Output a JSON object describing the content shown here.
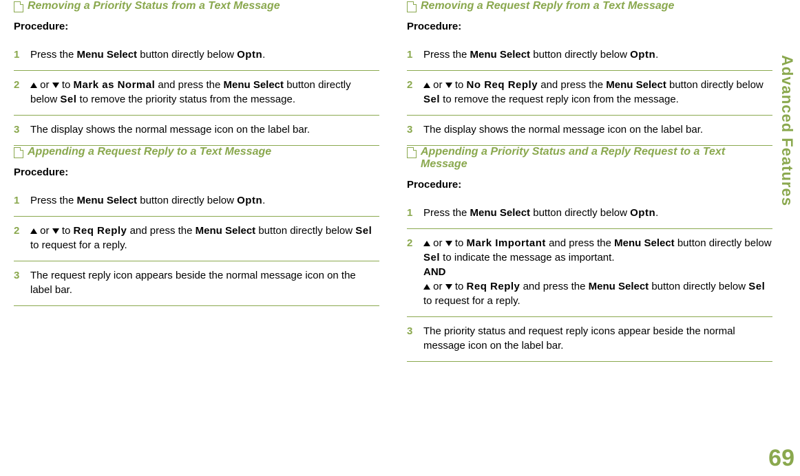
{
  "side_label": "Advanced Features",
  "page_number": "69",
  "procedure_label": "Procedure:",
  "ui": {
    "menu_select": "Menu Select",
    "optn": "Optn",
    "sel": "Sel",
    "mark_as_normal": "Mark as Normal",
    "req_reply": "Req Reply",
    "no_req_reply": "No Req Reply",
    "mark_important": "Mark Important",
    "and": "AND"
  },
  "sections": [
    {
      "title": "Removing a Priority Status from a Text Message",
      "steps": [
        {
          "n": "1",
          "t": [
            "Press the ",
            "@menu_select",
            " button directly below ",
            "@optn",
            "."
          ]
        },
        {
          "n": "2",
          "t": [
            "@up",
            " or ",
            "@down",
            " to ",
            "@mark_as_normal",
            " and press the ",
            "@menu_select",
            " button directly below ",
            "@sel",
            " to remove the priority status from the message."
          ]
        },
        {
          "n": "3",
          "t": [
            "The display shows the normal message icon on the label bar."
          ]
        }
      ]
    },
    {
      "title": "Appending a Request Reply to a Text Message",
      "steps": [
        {
          "n": "1",
          "t": [
            "Press the ",
            "@menu_select",
            " button directly below ",
            "@optn",
            "."
          ]
        },
        {
          "n": "2",
          "t": [
            "@up",
            " or ",
            "@down",
            " to ",
            "@req_reply",
            " and press the ",
            "@menu_select",
            " button directly below ",
            "@sel",
            " to request for a reply."
          ]
        },
        {
          "n": "3",
          "t": [
            "The request reply icon appears beside the normal message icon on the label bar."
          ]
        }
      ]
    },
    {
      "title": "Removing a Request Reply from a Text Message",
      "steps": [
        {
          "n": "1",
          "t": [
            "Press the ",
            "@menu_select",
            " button directly below ",
            "@optn",
            "."
          ]
        },
        {
          "n": "2",
          "t": [
            "@up",
            " or ",
            "@down",
            " to ",
            "@no_req_reply",
            " and press the ",
            "@menu_select",
            " button directly below ",
            "@sel",
            " to remove the request reply icon from the message."
          ]
        },
        {
          "n": "3",
          "t": [
            "The display shows the normal message icon on the label bar."
          ]
        }
      ]
    },
    {
      "title": "Appending a Priority Status and a Reply Request to a Text Message",
      "steps": [
        {
          "n": "1",
          "t": [
            "Press the ",
            "@menu_select",
            " button directly below ",
            "@optn",
            "."
          ]
        },
        {
          "n": "2",
          "t": [
            "@up",
            " or ",
            "@down",
            " to ",
            "@mark_important",
            " and press the ",
            "@menu_select",
            " button directly below ",
            "@sel",
            " to indicate the message as important.",
            "@br",
            "@and",
            "@br",
            "@up",
            " or ",
            "@down",
            " to ",
            "@req_reply",
            " and press the ",
            "@menu_select",
            " button directly below ",
            "@sel",
            " to request for a reply."
          ]
        },
        {
          "n": "3",
          "t": [
            "The priority status and request reply icons appear beside the normal message icon on the label bar."
          ]
        }
      ]
    }
  ]
}
